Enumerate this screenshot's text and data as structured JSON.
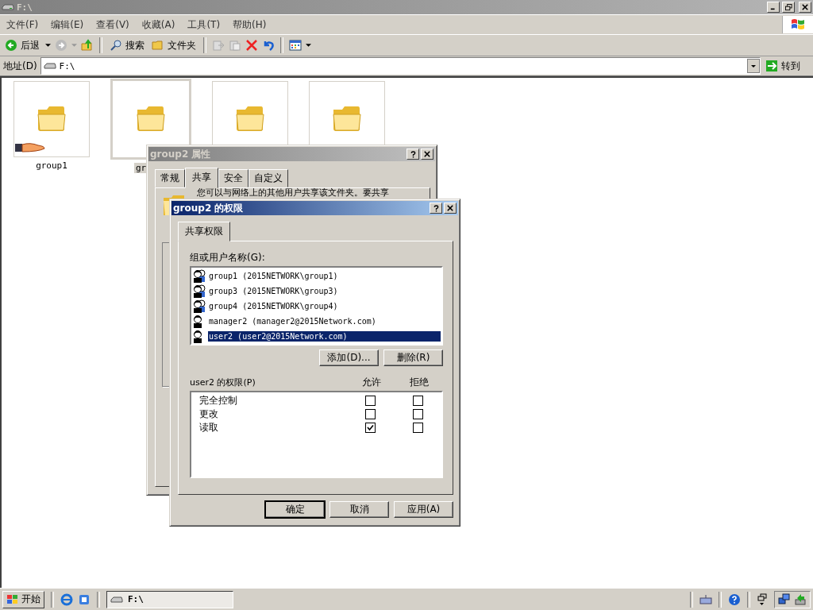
{
  "window": {
    "title": "F:\\"
  },
  "menu": [
    "文件(F)",
    "编辑(E)",
    "查看(V)",
    "收藏(A)",
    "工具(T)",
    "帮助(H)"
  ],
  "toolbar": {
    "back": "后退",
    "search": "搜索",
    "folders": "文件夹"
  },
  "address": {
    "label": "地址(D)",
    "value": "F:\\",
    "go": "转到"
  },
  "folders": [
    {
      "label": "group1",
      "shared": true,
      "selected": false
    },
    {
      "label": "gr",
      "shared": false,
      "selected": true
    },
    {
      "shared": false,
      "selected": false
    },
    {
      "shared": false,
      "selected": false
    }
  ],
  "properties_dialog": {
    "title": "group2 属性",
    "tabs": [
      {
        "label": "常规",
        "selected": false
      },
      {
        "label": "共享",
        "selected": true
      },
      {
        "label": "安全",
        "selected": false
      },
      {
        "label": "自定义",
        "selected": false
      }
    ],
    "text": "您可以与网络上的其他用户共享该文件夹。要共享"
  },
  "permissions_dialog": {
    "title": "group2 的权限",
    "tab": "共享权限",
    "users_label": "组或用户名称(G):",
    "users": [
      {
        "name": "group1 (2015NETWORK\\group1)",
        "kind": "group",
        "selected": false
      },
      {
        "name": "group3 (2015NETWORK\\group3)",
        "kind": "group",
        "selected": false
      },
      {
        "name": "group4 (2015NETWORK\\group4)",
        "kind": "group",
        "selected": false
      },
      {
        "name": "manager2 (manager2@2015Network.com)",
        "kind": "user",
        "selected": false
      },
      {
        "name": "user2 (user2@2015Network.com)",
        "kind": "user",
        "selected": true
      }
    ],
    "add": "添加(D)...",
    "remove": "删除(R)",
    "perm_label": "user2 的权限(P)",
    "allow": "允许",
    "deny": "拒绝",
    "permissions": [
      {
        "name": "完全控制",
        "allow": false,
        "deny": false
      },
      {
        "name": "更改",
        "allow": false,
        "deny": false
      },
      {
        "name": "读取",
        "allow": true,
        "deny": false
      }
    ],
    "buttons": [
      "确定",
      "取消",
      "应用(A)"
    ]
  },
  "taskbar": {
    "start": "开始",
    "task": "F:\\"
  }
}
